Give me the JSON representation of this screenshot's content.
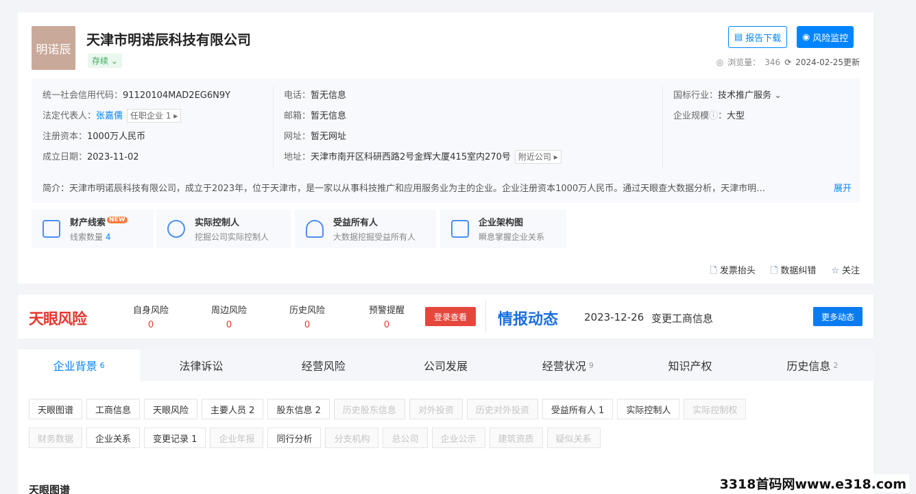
{
  "company": {
    "logo_text": "明诺辰",
    "name": "天津市明诺辰科技有限公司",
    "status": "存续",
    "report_btn": "报告下载",
    "monitor_btn": "风险监控",
    "views_label": "浏览量：",
    "views": "346",
    "updated": "2024-02-25更新"
  },
  "info": {
    "credit_code_label": "统一社会信用代码：",
    "credit_code": "91120104MAD2EG6N9Y",
    "legal_label": "法定代表人：",
    "legal_name": "张嘉儒",
    "legal_tag": "任职企业 1",
    "capital_label": "注册资本：",
    "capital": "1000万人民币",
    "founded_label": "成立日期：",
    "founded": "2023-11-02",
    "phone_label": "电话：",
    "phone": "暂无信息",
    "email_label": "邮箱：",
    "email": "暂无信息",
    "web_label": "网址：",
    "web": "暂无网址",
    "address_label": "地址：",
    "address": "天津市南开区科研西路2号金辉大厦415室内270号",
    "nearby_tag": "附近公司",
    "industry_label": "国标行业：",
    "industry": "技术推广服务",
    "scale_label": "企业规模",
    "scale": "大型",
    "intro": "简介：天津市明诺辰科技有限公司，成立于2023年，位于天津市，是一家以从事科技推广和应用服务业为主的企业。企业注册资本1000万人民币。通过天眼查大数据分析，天津市明…",
    "expand": "展开"
  },
  "features": [
    {
      "title": "财产线索",
      "badge": "NEW",
      "sub": "线索数量",
      "count": "4"
    },
    {
      "title": "实际控制人",
      "sub": "挖掘公司实际控制人"
    },
    {
      "title": "受益所有人",
      "sub": "大数据挖掘受益所有人"
    },
    {
      "title": "企业架构图",
      "sub": "瞬息掌握企业关系"
    }
  ],
  "actions": {
    "invoice": "发票抬头",
    "correct": "数据纠错",
    "follow": "关注"
  },
  "risk": {
    "logo": "天眼风险",
    "stats": [
      {
        "label": "自身风险",
        "value": "0"
      },
      {
        "label": "周边风险",
        "value": "0"
      },
      {
        "label": "历史风险",
        "value": "0"
      },
      {
        "label": "预警提醒",
        "value": "0"
      }
    ],
    "login_btn": "登录查看",
    "news_logo": "情报动态",
    "news_date": "2023-12-26",
    "news_text": "变更工商信息",
    "more_btn": "更多动态"
  },
  "tabs": [
    {
      "label": "企业背景",
      "count": "6"
    },
    {
      "label": "法律诉讼",
      "count": ""
    },
    {
      "label": "经营风险",
      "count": ""
    },
    {
      "label": "公司发展",
      "count": ""
    },
    {
      "label": "经营状况",
      "count": "9"
    },
    {
      "label": "知识产权",
      "count": ""
    },
    {
      "label": "历史信息",
      "count": "2"
    }
  ],
  "chips_row1": [
    {
      "label": "天眼图谱",
      "disabled": false
    },
    {
      "label": "工商信息",
      "disabled": false
    },
    {
      "label": "天眼风险",
      "disabled": false
    },
    {
      "label": "主要人员 2",
      "disabled": false
    },
    {
      "label": "股东信息 2",
      "disabled": false
    },
    {
      "label": "历史股东信息",
      "disabled": true
    },
    {
      "label": "对外投资",
      "disabled": true
    },
    {
      "label": "历史对外投资",
      "disabled": true
    },
    {
      "label": "受益所有人 1",
      "disabled": false
    },
    {
      "label": "实际控制人",
      "disabled": false
    },
    {
      "label": "实际控制权",
      "disabled": true
    }
  ],
  "chips_row2": [
    {
      "label": "财务数据",
      "disabled": true
    },
    {
      "label": "企业关系",
      "disabled": false
    },
    {
      "label": "变更记录 1",
      "disabled": false
    },
    {
      "label": "企业年报",
      "disabled": true
    },
    {
      "label": "同行分析",
      "disabled": false
    },
    {
      "label": "分支机构",
      "disabled": true
    },
    {
      "label": "总公司",
      "disabled": true
    },
    {
      "label": "企业公示",
      "disabled": true
    },
    {
      "label": "建筑资质",
      "disabled": true
    },
    {
      "label": "疑似关系",
      "disabled": true
    }
  ],
  "section_title": "天眼图谱",
  "watermark": "3318首码网www.e318.com"
}
